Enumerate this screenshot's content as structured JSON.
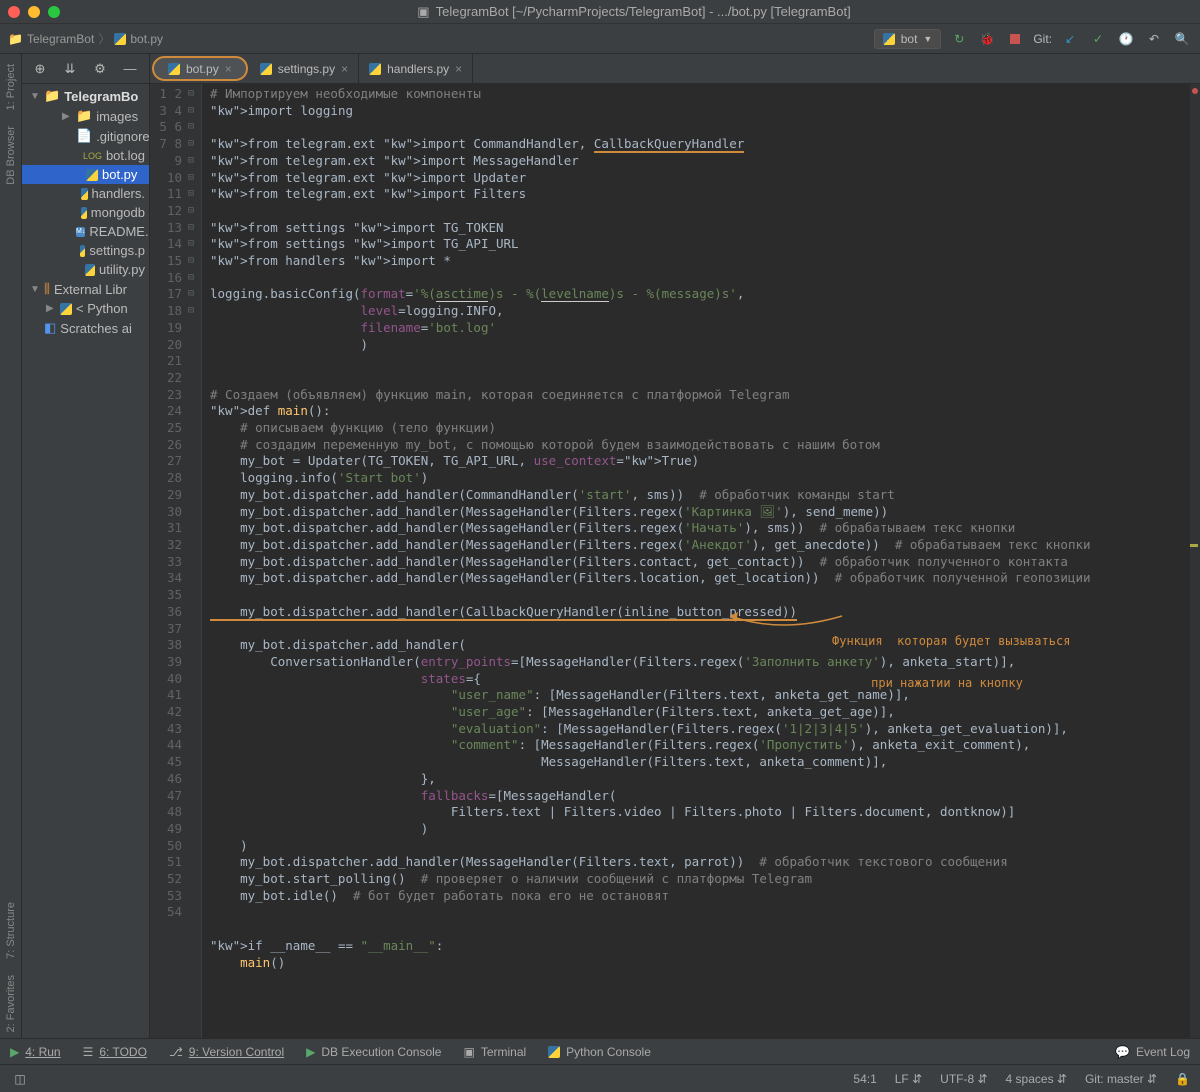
{
  "window": {
    "title": "TelegramBot [~/PycharmProjects/TelegramBot] - .../bot.py [TelegramBot]"
  },
  "breadcrumb": {
    "project": "TelegramBot",
    "file": "bot.py"
  },
  "run_config": {
    "name": "bot"
  },
  "git_label": "Git:",
  "tree": {
    "root": "TelegramBo",
    "items": [
      {
        "label": "images",
        "type": "folder",
        "indent": 2,
        "arrow": "▶"
      },
      {
        "label": ".gitignore",
        "type": "file",
        "indent": 3
      },
      {
        "label": "bot.log",
        "type": "log",
        "indent": 3
      },
      {
        "label": "bot.py",
        "type": "py",
        "indent": 3,
        "selected": true
      },
      {
        "label": "handlers.",
        "type": "py",
        "indent": 3
      },
      {
        "label": "mongodb",
        "type": "py",
        "indent": 3
      },
      {
        "label": "README.",
        "type": "md",
        "indent": 3
      },
      {
        "label": "settings.p",
        "type": "py",
        "indent": 3
      },
      {
        "label": "utility.py",
        "type": "py",
        "indent": 3
      }
    ],
    "external": "External Libr",
    "python_env": "< Python",
    "scratches": "Scratches ai"
  },
  "tabs": [
    {
      "label": "bot.py",
      "active": true,
      "highlighted": true
    },
    {
      "label": "settings.py"
    },
    {
      "label": "handlers.py"
    }
  ],
  "left_tabs": {
    "project": "1: Project",
    "db": "DB Browser",
    "structure": "7: Structure",
    "favorites": "2: Favorites"
  },
  "annotation": {
    "line1": "Функция  которая будет вызываться",
    "line2": "при нажатии на кнопку"
  },
  "bottom_tools": {
    "run": "4: Run",
    "todo": "6: TODO",
    "vcs": "9: Version Control",
    "db": "DB Execution Console",
    "terminal": "Terminal",
    "python": "Python Console",
    "eventlog": "Event Log"
  },
  "status": {
    "pos": "54:1",
    "lf": "LF",
    "encoding": "UTF-8",
    "indent": "4 spaces",
    "git_branch": "Git: master"
  },
  "code_lines": [
    "# Импортируем необходимые компоненты",
    "import logging",
    "",
    "from telegram.ext import CommandHandler, CallbackQueryHandler",
    "from telegram.ext import MessageHandler",
    "from telegram.ext import Updater",
    "from telegram.ext import Filters",
    "",
    "from settings import TG_TOKEN",
    "from settings import TG_API_URL",
    "from handlers import *",
    "",
    "logging.basicConfig(format='%(asctime)s - %(levelname)s - %(message)s',",
    "                    level=logging.INFO,",
    "                    filename='bot.log'",
    "                    )",
    "",
    "",
    "# Создаем (объявляем) функцию main, которая соединяется с платформой Telegram",
    "def main():",
    "    # описываем функцию (тело функции)",
    "    # создадим переменную my_bot, с помощью которой будем взаимодействовать с нашим ботом",
    "    my_bot = Updater(TG_TOKEN, TG_API_URL, use_context=True)",
    "    logging.info('Start bot')",
    "    my_bot.dispatcher.add_handler(CommandHandler('start', sms))  # обработчик команды start",
    "    my_bot.dispatcher.add_handler(MessageHandler(Filters.regex('Картинка 🖼'), send_meme))",
    "    my_bot.dispatcher.add_handler(MessageHandler(Filters.regex('Начать'), sms))  # обрабатываем текс кнопки",
    "    my_bot.dispatcher.add_handler(MessageHandler(Filters.regex('Анекдот'), get_anecdote))  # обрабатываем текс кнопки",
    "    my_bot.dispatcher.add_handler(MessageHandler(Filters.contact, get_contact))  # обработчик полученного контакта",
    "    my_bot.dispatcher.add_handler(MessageHandler(Filters.location, get_location))  # обработчик полученной геопозиции",
    "",
    "    my_bot.dispatcher.add_handler(CallbackQueryHandler(inline_button_pressed))",
    "",
    "    my_bot.dispatcher.add_handler(",
    "        ConversationHandler(entry_points=[MessageHandler(Filters.regex('Заполнить анкету'), anketa_start)],",
    "                            states={",
    "                                \"user_name\": [MessageHandler(Filters.text, anketa_get_name)],",
    "                                \"user_age\": [MessageHandler(Filters.text, anketa_get_age)],",
    "                                \"evaluation\": [MessageHandler(Filters.regex('1|2|3|4|5'), anketa_get_evaluation)],",
    "                                \"comment\": [MessageHandler(Filters.regex('Пропустить'), anketa_exit_comment),",
    "                                            MessageHandler(Filters.text, anketa_comment)],",
    "                            },",
    "                            fallbacks=[MessageHandler(",
    "                                Filters.text | Filters.video | Filters.photo | Filters.document, dontknow)]",
    "                            )",
    "    )",
    "    my_bot.dispatcher.add_handler(MessageHandler(Filters.text, parrot))  # обработчик текстового сообщения",
    "    my_bot.start_polling()  # проверяет о наличии сообщений с платформы Telegram",
    "    my_bot.idle()  # бот будет работать пока его не остановят",
    "",
    "",
    "if __name__ == \"__main__\":",
    "    main()",
    ""
  ],
  "line_start": 1,
  "line_end": 54
}
